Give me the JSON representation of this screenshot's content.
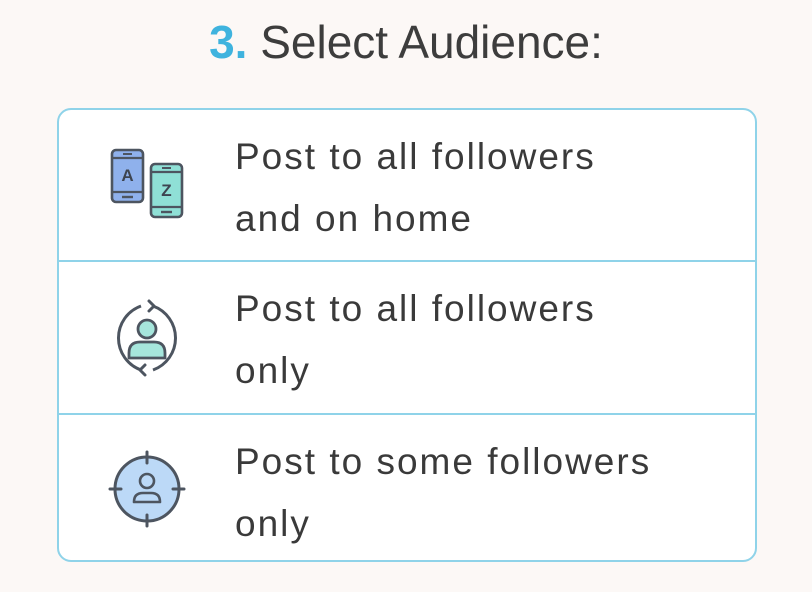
{
  "step": {
    "number": "3.",
    "title": "Select Audience:"
  },
  "options": [
    {
      "line1": "Post to all followers",
      "line2": "and on home",
      "icon": "phones-a-z-icon"
    },
    {
      "line1": "Post to all followers",
      "line2": "only",
      "icon": "user-refresh-icon"
    },
    {
      "line1": "Post to some followers",
      "line2": "only",
      "icon": "user-target-icon"
    }
  ],
  "icon_glyphs": {
    "phone_a": "A",
    "phone_z": "Z"
  },
  "colors": {
    "accent": "#3fb3de",
    "border": "#8fd3e9",
    "text": "#3a3a3a",
    "phone_a_fill": "#8fb1ec",
    "phone_z_fill": "#8fe0d6",
    "user_fill": "#a6e6dc",
    "target_fill": "#bcd9f7"
  }
}
